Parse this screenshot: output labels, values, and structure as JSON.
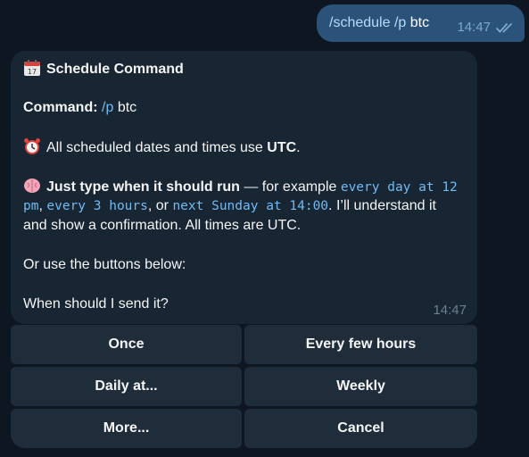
{
  "outgoing": {
    "command": "/schedule /p",
    "arg": "btc",
    "time": "14:47"
  },
  "incoming": {
    "title": "Schedule Command",
    "command_label": "Command:",
    "command_value": "/p",
    "command_arg": "btc",
    "utc_prefix": "All scheduled dates and times use",
    "utc_bold": "UTC",
    "utc_suffix": ".",
    "type_bold": "Just type when it should run",
    "type_mid": " — for example ",
    "example1a": "every day at 12",
    "example1b": "pm",
    "comma1": ",",
    "example2": "every 3 hours",
    "or_text": ", or ",
    "example3": "next Sunday at 14:00",
    "type_end": ". I’ll understand it",
    "confirm_line": "and show a confirmation. All times are UTC.",
    "buttons_hint": "Or use the buttons below:",
    "question": "When should I send it?",
    "time": "14:47",
    "icons": [
      "calendar-icon",
      "alarm-clock-icon",
      "brain-icon"
    ]
  },
  "keyboard": {
    "once": "Once",
    "every_few_hours": "Every few hours",
    "daily": "Daily at...",
    "weekly": "Weekly",
    "more": "More...",
    "cancel": "Cancel"
  },
  "colors": {
    "background": "#0e1621",
    "outgoing_bubble": "#2b5278",
    "incoming_bubble": "#182533",
    "button": "#1f2d3b",
    "link": "#71baf2"
  }
}
